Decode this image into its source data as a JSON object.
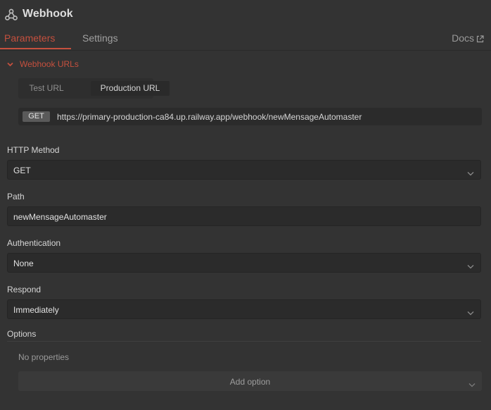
{
  "header": {
    "title": "Webhook",
    "icon": "webhook-icon"
  },
  "tabs": [
    {
      "label": "Parameters",
      "active": true
    },
    {
      "label": "Settings",
      "active": false
    }
  ],
  "docs_label": "Docs",
  "webhook_urls": {
    "section_label": "Webhook URLs",
    "toggle": [
      "Test URL",
      "Production URL"
    ],
    "selected": "Production URL",
    "method": "GET",
    "url": "https://primary-production-ca84.up.railway.app/webhook/newMensageAutomaster"
  },
  "fields": {
    "http_method": {
      "label": "HTTP Method",
      "value": "GET"
    },
    "path": {
      "label": "Path",
      "value": "newMensageAutomaster"
    },
    "authentication": {
      "label": "Authentication",
      "value": "None"
    },
    "respond": {
      "label": "Respond",
      "value": "Immediately"
    }
  },
  "options": {
    "label": "Options",
    "empty_text": "No properties",
    "add_label": "Add option"
  },
  "colors": {
    "accent": "#c5503e",
    "background": "#333333",
    "input": "#2b2b2b"
  }
}
